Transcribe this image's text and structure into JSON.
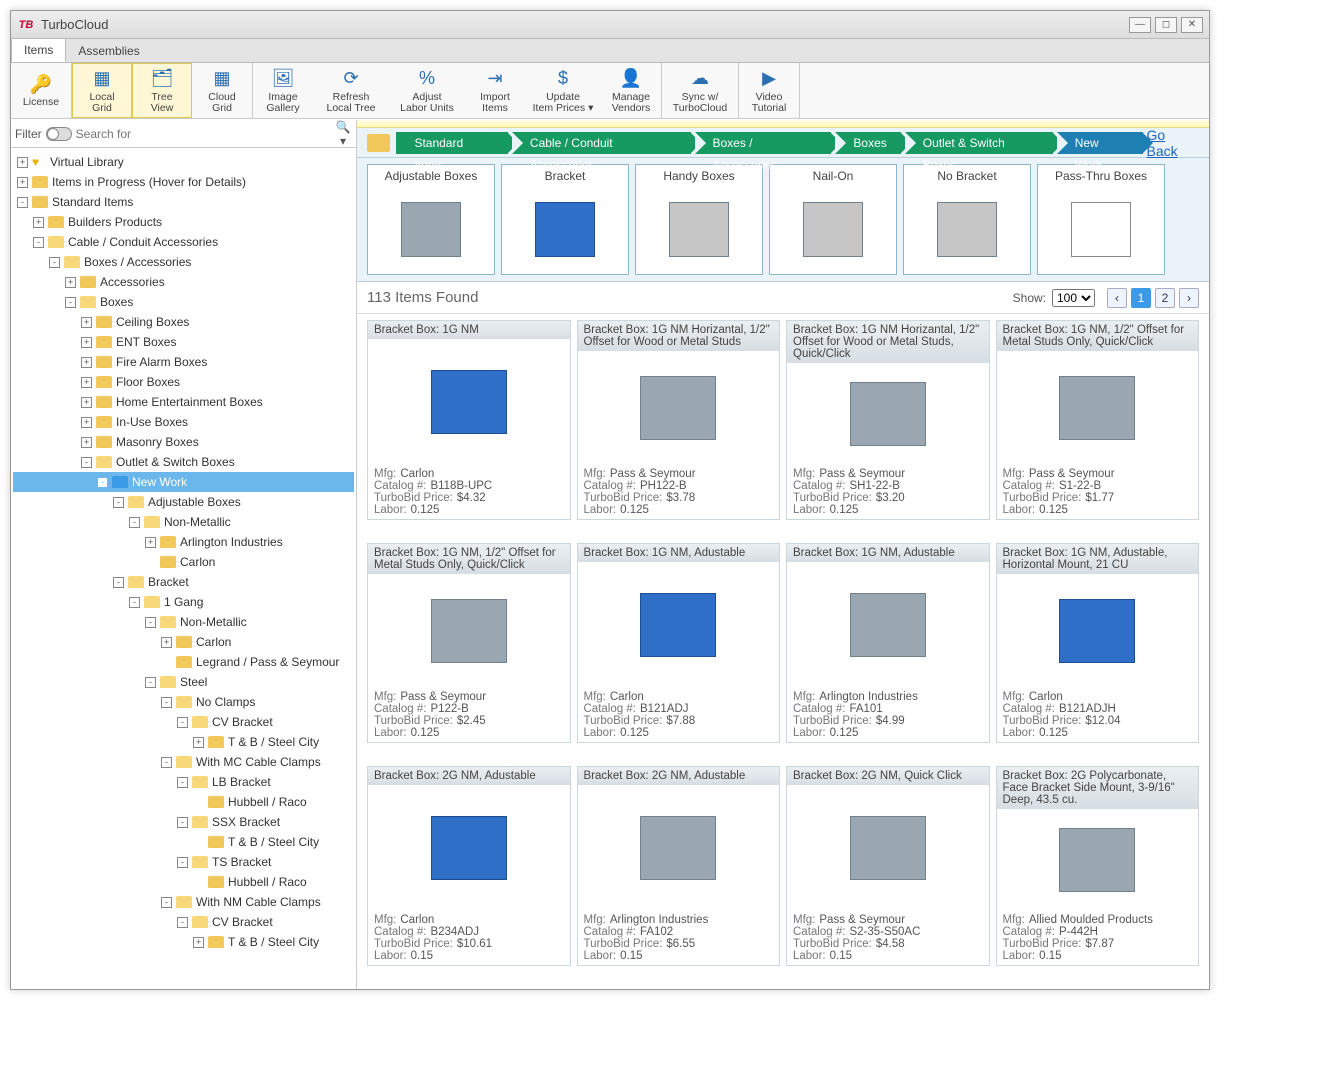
{
  "app": {
    "title": "TurboCloud",
    "logo_text": "TB"
  },
  "window_controls": {
    "min": "—",
    "max": "◻",
    "close": "✕"
  },
  "tabs": [
    {
      "label": "Items",
      "active": true
    },
    {
      "label": "Assemblies",
      "active": false
    }
  ],
  "toolbar": [
    {
      "icon": "🔑",
      "label": "License",
      "id": "license",
      "sel": false
    },
    {
      "icon": "▦",
      "label": "Local\nGrid",
      "id": "local-grid",
      "sel": true
    },
    {
      "icon": "🗂",
      "label": "Tree\nView",
      "id": "tree-view",
      "sel": true
    },
    {
      "icon": "▦",
      "label": "Cloud\nGrid",
      "id": "cloud-grid",
      "sel": false
    },
    {
      "icon": "🖼",
      "label": "Image\nGallery",
      "id": "image-gallery",
      "sel": false
    },
    {
      "icon": "⟳",
      "label": "Refresh\nLocal Tree",
      "id": "refresh-tree",
      "sel": false
    },
    {
      "icon": "%",
      "label": "Adjust\nLabor Units",
      "id": "adjust-labor",
      "sel": false
    },
    {
      "icon": "⇥",
      "label": "Import\nItems",
      "id": "import-items",
      "sel": false
    },
    {
      "icon": "$",
      "label": "Update\nItem Prices ▾",
      "id": "update-prices",
      "sel": false
    },
    {
      "icon": "👤",
      "label": "Manage\nVendors",
      "id": "manage-vendors",
      "sel": false
    },
    {
      "icon": "☁",
      "label": "Sync w/\nTurboCloud",
      "id": "sync-cloud",
      "sel": false
    },
    {
      "icon": "▶",
      "label": "Video\nTutorial",
      "id": "video-tutorial",
      "sel": false
    }
  ],
  "filter": {
    "label": "Filter",
    "placeholder": "Search for"
  },
  "tree": [
    {
      "d": 0,
      "sq": "+",
      "heart": true,
      "label": "Virtual Library"
    },
    {
      "d": 0,
      "sq": "+",
      "fld": "c",
      "label": "Items in Progress (Hover for Details)"
    },
    {
      "d": 0,
      "sq": "-",
      "fld": "c",
      "label": "Standard Items"
    },
    {
      "d": 1,
      "sq": "+",
      "fld": "c",
      "label": "Builders Products"
    },
    {
      "d": 1,
      "sq": "-",
      "fld": "o",
      "label": "Cable / Conduit Accessories"
    },
    {
      "d": 2,
      "sq": "-",
      "fld": "o",
      "label": "Boxes / Accessories"
    },
    {
      "d": 3,
      "sq": "+",
      "fld": "c",
      "label": "Accessories"
    },
    {
      "d": 3,
      "sq": "-",
      "fld": "o",
      "label": "Boxes"
    },
    {
      "d": 4,
      "sq": "+",
      "fld": "c",
      "label": "Ceiling Boxes"
    },
    {
      "d": 4,
      "sq": "+",
      "fld": "c",
      "label": "ENT Boxes"
    },
    {
      "d": 4,
      "sq": "+",
      "fld": "c",
      "label": "Fire Alarm Boxes"
    },
    {
      "d": 4,
      "sq": "+",
      "fld": "c",
      "label": "Floor Boxes"
    },
    {
      "d": 4,
      "sq": "+",
      "fld": "c",
      "label": "Home Entertainment Boxes"
    },
    {
      "d": 4,
      "sq": "+",
      "fld": "c",
      "label": "In-Use Boxes"
    },
    {
      "d": 4,
      "sq": "+",
      "fld": "c",
      "label": "Masonry Boxes"
    },
    {
      "d": 4,
      "sq": "-",
      "fld": "o",
      "label": "Outlet & Switch Boxes"
    },
    {
      "d": 5,
      "sq": "-",
      "fld": "b",
      "label": "New Work",
      "sel": true
    },
    {
      "d": 6,
      "sq": "-",
      "fld": "o",
      "label": "Adjustable Boxes"
    },
    {
      "d": 7,
      "sq": "-",
      "fld": "o",
      "label": "Non-Metallic"
    },
    {
      "d": 8,
      "sq": "+",
      "fld": "c",
      "label": "Arlington Industries"
    },
    {
      "d": 8,
      "sq": " ",
      "fld": "c",
      "label": "Carlon"
    },
    {
      "d": 6,
      "sq": "-",
      "fld": "o",
      "label": "Bracket"
    },
    {
      "d": 7,
      "sq": "-",
      "fld": "o",
      "label": "1 Gang"
    },
    {
      "d": 8,
      "sq": "-",
      "fld": "o",
      "label": "Non-Metallic"
    },
    {
      "d": 9,
      "sq": "+",
      "fld": "c",
      "label": "Carlon"
    },
    {
      "d": 9,
      "sq": " ",
      "fld": "c",
      "label": "Legrand / Pass & Seymour"
    },
    {
      "d": 8,
      "sq": "-",
      "fld": "o",
      "label": "Steel"
    },
    {
      "d": 9,
      "sq": "-",
      "fld": "o",
      "label": "No Clamps"
    },
    {
      "d": 10,
      "sq": "-",
      "fld": "o",
      "label": "CV Bracket"
    },
    {
      "d": 11,
      "sq": "+",
      "fld": "c",
      "label": "T & B / Steel City"
    },
    {
      "d": 9,
      "sq": "-",
      "fld": "o",
      "label": "With MC Cable Clamps"
    },
    {
      "d": 10,
      "sq": "-",
      "fld": "o",
      "label": "LB Bracket"
    },
    {
      "d": 11,
      "sq": " ",
      "fld": "c",
      "label": "Hubbell / Raco"
    },
    {
      "d": 10,
      "sq": "-",
      "fld": "o",
      "label": "SSX Bracket"
    },
    {
      "d": 11,
      "sq": " ",
      "fld": "c",
      "label": "T & B / Steel City"
    },
    {
      "d": 10,
      "sq": "-",
      "fld": "o",
      "label": "TS Bracket"
    },
    {
      "d": 11,
      "sq": " ",
      "fld": "c",
      "label": "Hubbell / Raco"
    },
    {
      "d": 9,
      "sq": "-",
      "fld": "o",
      "label": "With NM Cable Clamps"
    },
    {
      "d": 10,
      "sq": "-",
      "fld": "o",
      "label": "CV Bracket"
    },
    {
      "d": 11,
      "sq": "+",
      "fld": "c",
      "label": "T & B / Steel City"
    }
  ],
  "breadcrumbs": [
    {
      "label": "Standard Items",
      "blue": false
    },
    {
      "label": "Cable / Conduit Accessories",
      "blue": false
    },
    {
      "label": "Boxes / Accessories",
      "blue": false
    },
    {
      "label": "Boxes",
      "blue": false
    },
    {
      "label": "Outlet & Switch Boxes",
      "blue": false
    },
    {
      "label": "New Work",
      "blue": true
    }
  ],
  "go_back": "Go Back",
  "categories": [
    {
      "label": "Adjustable Boxes",
      "col": ""
    },
    {
      "label": "Bracket",
      "col": "blue"
    },
    {
      "label": "Handy Boxes",
      "col": "sil"
    },
    {
      "label": "Nail-On",
      "col": "sil"
    },
    {
      "label": "No Bracket",
      "col": "sil"
    },
    {
      "label": "Pass-Thru Boxes",
      "col": "lin"
    }
  ],
  "results": {
    "count_text": "113 Items Found",
    "show_label": "Show:",
    "show_value": "100",
    "pages": [
      "1",
      "2"
    ],
    "current_page": "1"
  },
  "labels": {
    "mfg": "Mfg:",
    "catalog": "Catalog #:",
    "price": "TurboBid Price:",
    "labor": "Labor:"
  },
  "items": [
    {
      "title": "Bracket Box: 1G NM",
      "mfg": "Carlon",
      "cat": "B118B-UPC",
      "price": "$4.32",
      "labor": "0.125",
      "col": "blue"
    },
    {
      "title": "Bracket Box: 1G NM Horizantal, 1/2\" Offset for Wood or Metal Studs",
      "mfg": "Pass & Seymour",
      "cat": "PH122-B",
      "price": "$3.78",
      "labor": "0.125",
      "col": ""
    },
    {
      "title": "Bracket Box: 1G NM Horizantal, 1/2\" Offset for Wood or Metal Studs, Quick/Click",
      "mfg": "Pass & Seymour",
      "cat": "SH1-22-B",
      "price": "$3.20",
      "labor": "0.125",
      "col": ""
    },
    {
      "title": "Bracket Box: 1G NM, 1/2\" Offset for Metal Studs Only, Quick/Click",
      "mfg": "Pass & Seymour",
      "cat": "S1-22-B",
      "price": "$1.77",
      "labor": "0.125",
      "col": ""
    },
    {
      "title": "Bracket Box: 1G NM, 1/2\" Offset for Metal Studs Only, Quick/Click",
      "mfg": "Pass & Seymour",
      "cat": "P122-B",
      "price": "$2.45",
      "labor": "0.125",
      "col": ""
    },
    {
      "title": "Bracket Box: 1G NM, Adustable",
      "mfg": "Carlon",
      "cat": "B121ADJ",
      "price": "$7.88",
      "labor": "0.125",
      "col": "blue"
    },
    {
      "title": "Bracket Box: 1G NM, Adustable",
      "mfg": "Arlington Industries",
      "cat": "FA101",
      "price": "$4.99",
      "labor": "0.125",
      "col": ""
    },
    {
      "title": "Bracket Box: 1G NM, Adustable, Horizontal Mount, 21 CU",
      "mfg": "Carlon",
      "cat": "B121ADJH",
      "price": "$12.04",
      "labor": "0.125",
      "col": "blue"
    },
    {
      "title": "Bracket Box: 2G NM, Adustable",
      "mfg": "Carlon",
      "cat": "B234ADJ",
      "price": "$10.61",
      "labor": "0.15",
      "col": "blue"
    },
    {
      "title": "Bracket Box: 2G NM, Adustable",
      "mfg": "Arlington Industries",
      "cat": "FA102",
      "price": "$6.55",
      "labor": "0.15",
      "col": ""
    },
    {
      "title": "Bracket Box: 2G NM, Quick Click",
      "mfg": "Pass & Seymour",
      "cat": "S2-35-S50AC",
      "price": "$4.58",
      "labor": "0.15",
      "col": ""
    },
    {
      "title": "Bracket Box: 2G Polycarbonate, Face Bracket Side Mount, 3-9/16\" Deep, 43.5 cu.",
      "mfg": "Allied Moulded Products",
      "cat": "P-442H",
      "price": "$7.87",
      "labor": "0.15",
      "col": ""
    }
  ]
}
